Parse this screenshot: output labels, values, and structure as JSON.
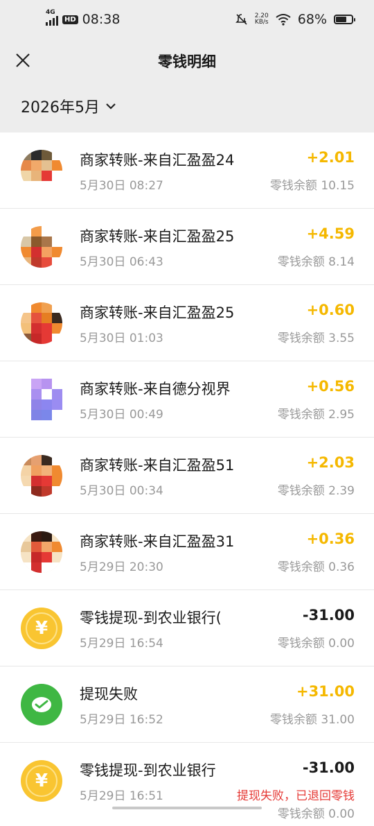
{
  "status_bar": {
    "network": "4G",
    "hd": "HD",
    "time": "08:38",
    "speed_value": "2.20",
    "speed_unit": "KB/s",
    "battery": "68%",
    "battery_level": 0.68
  },
  "nav": {
    "title": "零钱明细"
  },
  "filter": {
    "month": "2026年5月"
  },
  "transactions": [
    {
      "title": "商家转账-来自汇盈盈24",
      "time": "5月30日 08:27",
      "amount": "+2.01",
      "balance": "零钱余额 10.15"
    },
    {
      "title": "商家转账-来自汇盈盈25",
      "time": "5月30日 06:43",
      "amount": "+4.59",
      "balance": "零钱余额 8.14"
    },
    {
      "title": "商家转账-来自汇盈盈25",
      "time": "5月30日 01:03",
      "amount": "+0.60",
      "balance": "零钱余额 3.55"
    },
    {
      "title": "商家转账-来自德分视界",
      "time": "5月30日 00:49",
      "amount": "+0.56",
      "balance": "零钱余额 2.95"
    },
    {
      "title": "商家转账-来自汇盈盈51",
      "time": "5月30日 00:34",
      "amount": "+2.03",
      "balance": "零钱余额 2.39"
    },
    {
      "title": "商家转账-来自汇盈盈31",
      "time": "5月29日 20:30",
      "amount": "+0.36",
      "balance": "零钱余额 0.36"
    },
    {
      "title": "零钱提现-到农业银行(",
      "time": "5月29日 16:54",
      "amount": "-31.00",
      "balance": "零钱余额 0.00"
    },
    {
      "title": "提现失败",
      "time": "5月29日 16:52",
      "amount": "+31.00",
      "balance": "零钱余额 31.00"
    },
    {
      "title": "零钱提现-到农业银行",
      "time": "5月29日 16:51",
      "amount": "-31.00",
      "note": "提现失败，已退回零钱",
      "balance": "零钱余额 0.00"
    }
  ],
  "icons": {
    "close": "close-icon",
    "dropdown": "chevron-down-icon",
    "coin": "yuan-coin-icon",
    "wechat": "wechat-pay-icon"
  },
  "colors": {
    "income": "#f5b800",
    "expense": "#1a1a1a",
    "note": "#e53935",
    "coin": "#f9c531",
    "wechat": "#3fb743"
  }
}
